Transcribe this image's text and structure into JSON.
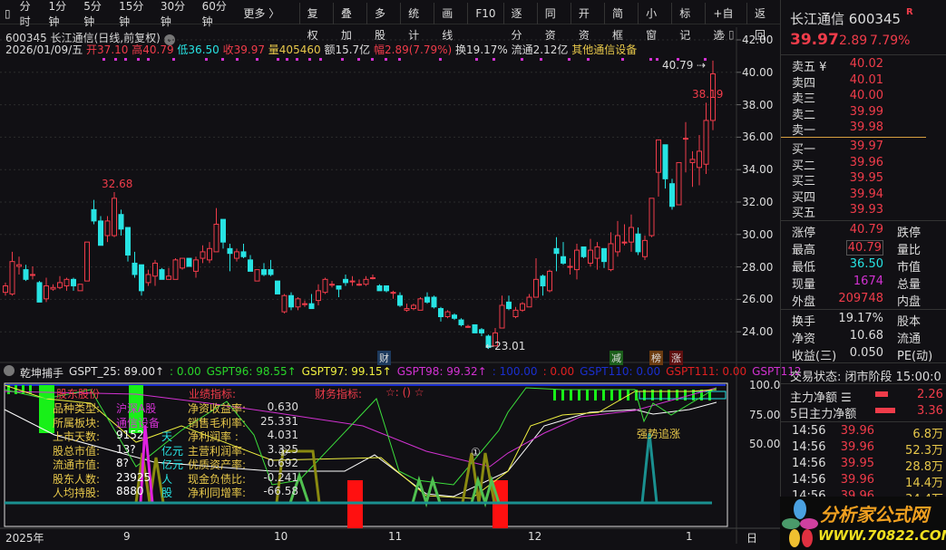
{
  "toolbar": {
    "periods": [
      "分时",
      "1分钟",
      "5分钟",
      "15分钟",
      "30分钟",
      "60分钟"
    ],
    "more": "更多 〉",
    "buttons": [
      "复权",
      "叠加",
      "多股",
      "统计",
      "画线",
      "F10",
      "逐分",
      "同资",
      "开资",
      "简框",
      "小窗",
      "标记",
      "+自选",
      "返回"
    ]
  },
  "header": {
    "title": "600345 长江通信(日线,前复权)",
    "date": "2026/01/09/五",
    "open": "开37.10",
    "high": "高40.79",
    "low": "低36.50",
    "close": "收39.97",
    "vol": "量405460",
    "amount": "额15.7亿",
    "change": "幅2.89(7.79%)",
    "turnover": "换19.17%",
    "float": "流通2.12亿",
    "sector": "其他通信设备"
  },
  "price_axis": [
    "42.00",
    "40.00",
    "38.00",
    "36.00",
    "34.00",
    "32.00",
    "30.00",
    "28.00",
    "26.00",
    "24.00"
  ],
  "annotations": {
    "high_a": "32.68",
    "high_b": "40.79",
    "mark_b": "38.19",
    "low": "23.01",
    "events": [
      "财",
      "减",
      "榜",
      "涨"
    ]
  },
  "kline": [
    [
      26.5,
      26.9,
      27.1,
      26.3
    ],
    [
      26.4,
      28.4,
      29.0,
      26.3
    ],
    [
      28.1,
      28.2,
      28.7,
      27.6
    ],
    [
      27.9,
      27.3,
      28.2,
      27.2
    ],
    [
      27.6,
      27.6,
      28.1,
      27.3
    ],
    [
      27.1,
      25.9,
      27.2,
      25.9
    ],
    [
      26.1,
      26.9,
      27.4,
      25.9
    ],
    [
      26.7,
      26.8,
      27.0,
      26.6
    ],
    [
      26.8,
      27.1,
      27.5,
      26.7
    ],
    [
      26.9,
      27.3,
      27.4,
      26.6
    ],
    [
      27.3,
      26.9,
      27.4,
      26.6
    ],
    [
      26.6,
      27.0,
      27.0,
      26.6
    ],
    [
      27.2,
      29.6,
      29.6,
      27.2
    ],
    [
      31.6,
      30.9,
      32.2,
      30.7
    ],
    [
      30.9,
      29.4,
      31.2,
      29.4
    ],
    [
      30.0,
      30.9,
      31.2,
      29.6
    ],
    [
      30.0,
      32.3,
      32.68,
      29.9
    ],
    [
      31.3,
      30.4,
      31.6,
      30.0
    ],
    [
      30.5,
      28.8,
      30.5,
      28.4
    ],
    [
      28.3,
      27.6,
      29.0,
      27.4
    ],
    [
      28.2,
      26.6,
      28.2,
      26.3
    ],
    [
      27.1,
      27.6,
      27.9,
      26.9
    ],
    [
      27.5,
      28.3,
      28.5,
      26.9
    ],
    [
      27.9,
      27.3,
      28.0,
      27.3
    ],
    [
      27.3,
      27.5,
      28.0,
      27.3
    ],
    [
      27.3,
      28.5,
      28.6,
      27.3
    ],
    [
      28.0,
      28.6,
      28.6,
      27.9
    ],
    [
      28.6,
      28.1,
      28.6,
      28.1
    ],
    [
      27.8,
      28.5,
      28.7,
      27.4
    ],
    [
      28.6,
      29.0,
      29.4,
      28.3
    ],
    [
      28.5,
      29.2,
      29.6,
      28.3
    ],
    [
      29.0,
      30.7,
      31.7,
      29.0
    ],
    [
      31.0,
      29.6,
      31.0,
      29.2
    ],
    [
      29.2,
      28.9,
      29.5,
      27.8
    ],
    [
      28.6,
      29.0,
      29.2,
      28.4
    ],
    [
      29.0,
      28.7,
      29.5,
      28.6
    ],
    [
      28.5,
      27.8,
      28.8,
      27.8
    ],
    [
      27.2,
      27.9,
      27.9,
      27.2
    ],
    [
      27.9,
      27.6,
      28.3,
      27.5
    ],
    [
      27.9,
      27.6,
      28.5,
      27.5
    ],
    [
      27.2,
      26.4,
      27.2,
      26.4
    ],
    [
      25.3,
      26.3,
      26.4,
      25.2
    ],
    [
      26.3,
      25.6,
      26.5,
      25.4
    ],
    [
      25.6,
      26.1,
      26.2,
      25.4
    ],
    [
      25.8,
      25.8,
      26.0,
      25.6
    ],
    [
      25.8,
      25.5,
      26.4,
      25.5
    ],
    [
      26.0,
      26.6,
      27.0,
      25.7
    ],
    [
      26.5,
      27.3,
      27.4,
      26.4
    ],
    [
      27.0,
      27.0,
      27.2,
      26.8
    ],
    [
      26.9,
      26.7,
      26.9,
      26.2
    ],
    [
      27.3,
      27.1,
      27.6,
      26.9
    ],
    [
      27.2,
      27.2,
      27.5,
      26.9
    ],
    [
      27.0,
      27.0,
      27.3,
      26.9
    ],
    [
      27.0,
      27.3,
      27.5,
      26.9
    ],
    [
      27.4,
      27.4,
      27.6,
      27.3
    ],
    [
      26.9,
      26.6,
      27.0,
      26.6
    ],
    [
      26.9,
      26.6,
      26.9,
      26.5
    ],
    [
      26.5,
      26.5,
      26.6,
      26.1
    ],
    [
      26.3,
      25.7,
      26.5,
      25.6
    ],
    [
      25.4,
      25.5,
      25.8,
      25.3
    ],
    [
      25.5,
      25.7,
      25.8,
      25.4
    ],
    [
      25.4,
      26.1,
      26.2,
      25.4
    ],
    [
      26.2,
      25.9,
      26.5,
      25.8
    ],
    [
      26.2,
      25.6,
      26.3,
      25.5
    ],
    [
      25.5,
      25.0,
      25.6,
      24.7
    ],
    [
      25.0,
      25.3,
      25.4,
      24.9
    ],
    [
      25.1,
      24.9,
      25.2,
      24.8
    ],
    [
      24.8,
      24.5,
      24.9,
      24.4
    ],
    [
      24.4,
      24.4,
      24.5,
      24.3
    ],
    [
      24.5,
      24.0,
      24.5,
      24.0
    ],
    [
      24.2,
      24.0,
      24.3,
      23.8
    ],
    [
      23.8,
      23.1,
      23.9,
      23.01
    ],
    [
      23.2,
      24.0,
      24.3,
      23.2
    ],
    [
      24.3,
      25.7,
      26.3,
      24.3
    ],
    [
      25.9,
      25.5,
      26.3,
      25.4
    ],
    [
      25.0,
      25.4,
      25.6,
      24.9
    ],
    [
      25.4,
      25.8,
      25.9,
      25.3
    ],
    [
      25.6,
      26.2,
      26.4,
      25.6
    ],
    [
      26.2,
      27.3,
      28.6,
      26.2
    ],
    [
      27.5,
      26.9,
      27.6,
      26.3
    ],
    [
      26.6,
      27.8,
      27.9,
      26.5
    ],
    [
      29.2,
      28.9,
      29.9,
      27.8
    ],
    [
      28.7,
      28.3,
      29.6,
      28.2
    ],
    [
      28.1,
      28.1,
      28.6,
      27.6
    ],
    [
      27.9,
      29.1,
      29.5,
      27.3
    ],
    [
      29.3,
      28.7,
      29.3,
      28.6
    ],
    [
      28.3,
      29.1,
      29.8,
      28.1
    ],
    [
      28.6,
      29.3,
      29.6,
      27.9
    ],
    [
      29.2,
      28.4,
      29.2,
      28.0
    ],
    [
      27.9,
      29.5,
      30.2,
      27.8
    ],
    [
      29.0,
      30.0,
      30.9,
      28.7
    ],
    [
      29.6,
      29.6,
      30.7,
      29.4
    ],
    [
      29.6,
      30.5,
      31.3,
      29.0
    ],
    [
      30.1,
      29.0,
      30.5,
      28.8
    ],
    [
      28.7,
      29.7,
      30.0,
      28.5
    ],
    [
      30.0,
      32.3,
      32.3,
      29.9
    ],
    [
      33.9,
      35.9,
      35.9,
      32.4
    ],
    [
      35.6,
      33.5,
      35.6,
      32.9
    ],
    [
      33.2,
      31.8,
      33.5,
      31.6
    ],
    [
      31.9,
      34.5,
      34.5,
      31.9
    ],
    [
      36.0,
      36.0,
      37.0,
      33.9
    ],
    [
      34.5,
      34.7,
      35.2,
      33.0
    ],
    [
      34.2,
      35.2,
      36.2,
      33.1
    ],
    [
      34.4,
      37.1,
      38.19,
      33.8
    ],
    [
      37.1,
      39.97,
      40.79,
      36.5
    ]
  ],
  "indicator": {
    "name": "乾坤捕手",
    "items": [
      {
        "t": "GSPT_25: 89.00↑",
        "c": "#e0e0e0"
      },
      {
        "t": ": 0.00",
        "c": "#29d629"
      },
      {
        "t": "GSPT96: 98.55↑",
        "c": "#29d629"
      },
      {
        "t": "GSPT97: 99.15↑",
        "c": "#f0f040"
      },
      {
        "t": "GSPT98: 99.32↑",
        "c": "#d232d2"
      },
      {
        "t": ": 100.00",
        "c": "#1a2fcf"
      },
      {
        "t": ": 0.00",
        "c": "#e02020"
      },
      {
        "t": "GSPT110: 0.00",
        "c": "#1a2fcf"
      },
      {
        "t": "GSPT111: 0.00",
        "c": "#e02020"
      },
      {
        "t": "GSPT112",
        "c": "#d232d2"
      }
    ],
    "axis": [
      "100.0",
      "75.00",
      "50.00"
    ],
    "signal": "强势追涨",
    "circle": "①",
    "info": {
      "h1": "股东股份",
      "h2": "业绩指标:",
      "h3": "财务指标:",
      "h4": "☆: () ☆",
      "rows": [
        {
          "l": "品种类型:",
          "v": "沪深A股",
          "u": ""
        },
        {
          "l": "所属板块:",
          "v": "通信设备",
          "u": ""
        },
        {
          "l": "上市天数:",
          "v": "9152",
          "u": "天"
        },
        {
          "l": "股总市值:",
          "v": "13?",
          "u": "亿元"
        },
        {
          "l": "流通市值:",
          "v": "8?",
          "u": "亿元"
        },
        {
          "l": "股东人数:",
          "v": "23925",
          "u": "人"
        },
        {
          "l": "人均持股:",
          "v": "8880",
          "u": "股"
        }
      ],
      "perf": [
        {
          "l": "净资收益率:",
          "v": "0.630"
        },
        {
          "l": "销售毛利率:",
          "v": "25.331"
        },
        {
          "l": "净利润率 :",
          "v": "4.031"
        },
        {
          "l": "主营利润率:",
          "v": "3.325"
        },
        {
          "l": "优质资产率:",
          "v": "0.692"
        },
        {
          "l": "现金负债比:",
          "v": "-0.241"
        },
        {
          "l": "净利同增率:",
          "v": "-66.58"
        }
      ]
    }
  },
  "date_axis": [
    "2025年",
    "9",
    "10",
    "11",
    "12",
    "1",
    "日"
  ],
  "panel": {
    "name": "长江通信",
    "code": "600345",
    "badge": "R",
    "price": "39.97",
    "chg": "2.89",
    "pct": "7.79%",
    "sells": [
      {
        "l": "卖五 ¥",
        "v": "40.02"
      },
      {
        "l": "卖四",
        "v": "40.01"
      },
      {
        "l": "卖三",
        "v": "40.00"
      },
      {
        "l": "卖二",
        "v": "39.99"
      },
      {
        "l": "卖一",
        "v": "39.98"
      }
    ],
    "buys": [
      {
        "l": "买一",
        "v": "39.97"
      },
      {
        "l": "买二",
        "v": "39.96"
      },
      {
        "l": "买三",
        "v": "39.95"
      },
      {
        "l": "买四",
        "v": "39.94"
      },
      {
        "l": "买五",
        "v": "39.93"
      }
    ],
    "stats": [
      {
        "l": "涨停",
        "v": "40.79",
        "r": "跌停",
        "c": "red"
      },
      {
        "l": "最高",
        "v": "40.79",
        "r": "量比",
        "c": "red"
      },
      {
        "l": "最低",
        "v": "36.50",
        "r": "市值",
        "c": "cyan"
      },
      {
        "l": "现量",
        "v": "1674",
        "r": "总量",
        "c": "mag"
      },
      {
        "l": "外盘",
        "v": "209748",
        "r": "内盘",
        "c": "red"
      }
    ],
    "stats2": [
      {
        "l": "换手",
        "v": "19.17%",
        "r": "股本"
      },
      {
        "l": "净资",
        "v": "10.68",
        "r": "流通"
      },
      {
        "l": "收益(三)",
        "v": "0.050",
        "r": "PE(动)"
      }
    ],
    "status": "交易状态: 闭市阶段 15:00:0",
    "main_net": "主力净额",
    "main_net_v": "2.26",
    "net5": "5日主力净额",
    "net5_v": "3.36",
    "ticks": [
      {
        "t": "14:56",
        "p": "39.96",
        "v": "6.8万"
      },
      {
        "t": "14:56",
        "p": "39.96",
        "v": "52.3万"
      },
      {
        "t": "14:56",
        "p": "39.95",
        "v": "28.8万"
      },
      {
        "t": "14:56",
        "p": "39.96",
        "v": "14.4万"
      },
      {
        "t": "14:56",
        "p": "39.96",
        "v": "34.4万"
      }
    ]
  },
  "logo": {
    "name": "分析家公式网",
    "url": "WWW.70822.COM"
  },
  "colors": {
    "up": "#f03c4a",
    "down": "#27e3e3"
  }
}
